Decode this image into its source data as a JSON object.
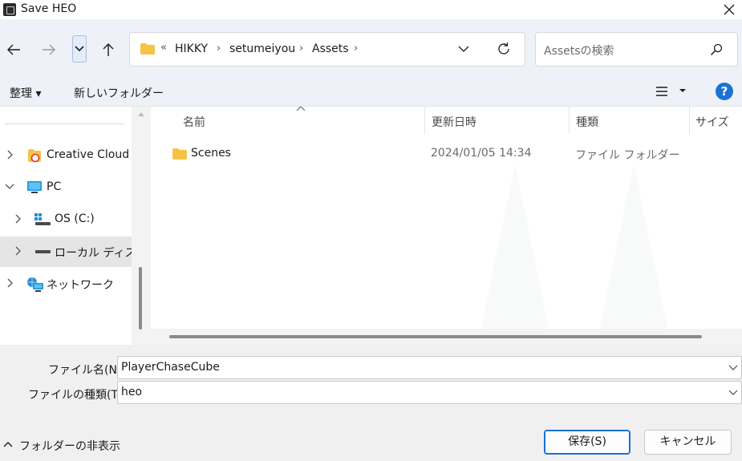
{
  "window": {
    "title": "Save HEO"
  },
  "address_bar": {
    "overflow_marker": "«",
    "crumbs": [
      "HIKKY",
      "setumeiyou",
      "Assets"
    ]
  },
  "search": {
    "placeholder": "Assetsの検索"
  },
  "command_bar": {
    "organize_label": "整理 ▾",
    "new_folder_label": "新しいフォルダー",
    "help_label": "?"
  },
  "nav_pane": {
    "items": [
      {
        "label": "Creative Cloud Files",
        "icon": "creative-cloud-icon",
        "expanded": false
      },
      {
        "label": "PC",
        "icon": "pc-monitor-icon",
        "expanded": true
      },
      {
        "label": "OS (C:)",
        "icon": "windows-drive-icon",
        "expanded": false
      },
      {
        "label": "ローカル ディスク",
        "icon": "disk-drive-icon",
        "expanded": false,
        "selected": true
      },
      {
        "label": "ネットワーク",
        "icon": "network-icon",
        "expanded": false
      }
    ]
  },
  "file_list": {
    "columns": [
      "名前",
      "更新日時",
      "種類",
      "サイズ"
    ],
    "rows": [
      {
        "name": "Scenes",
        "modified": "2024/01/05 14:34",
        "type": "ファイル フォルダー",
        "size": ""
      }
    ]
  },
  "save_form": {
    "filename_label": "ファイル名(N):",
    "filename_value": "PlayerChaseCube",
    "filetype_label": "ファイルの種類(T):",
    "filetype_value": "heo"
  },
  "footer": {
    "hide_folders_label": "フォルダーの非表示",
    "save_label": "保存(S)",
    "cancel_label": "キャンセル"
  },
  "colors": {
    "accent": "#1a6fd1",
    "folder": "#f5c446",
    "chrome_background": "#eef2f8",
    "help_icon": "#1a73d4"
  }
}
